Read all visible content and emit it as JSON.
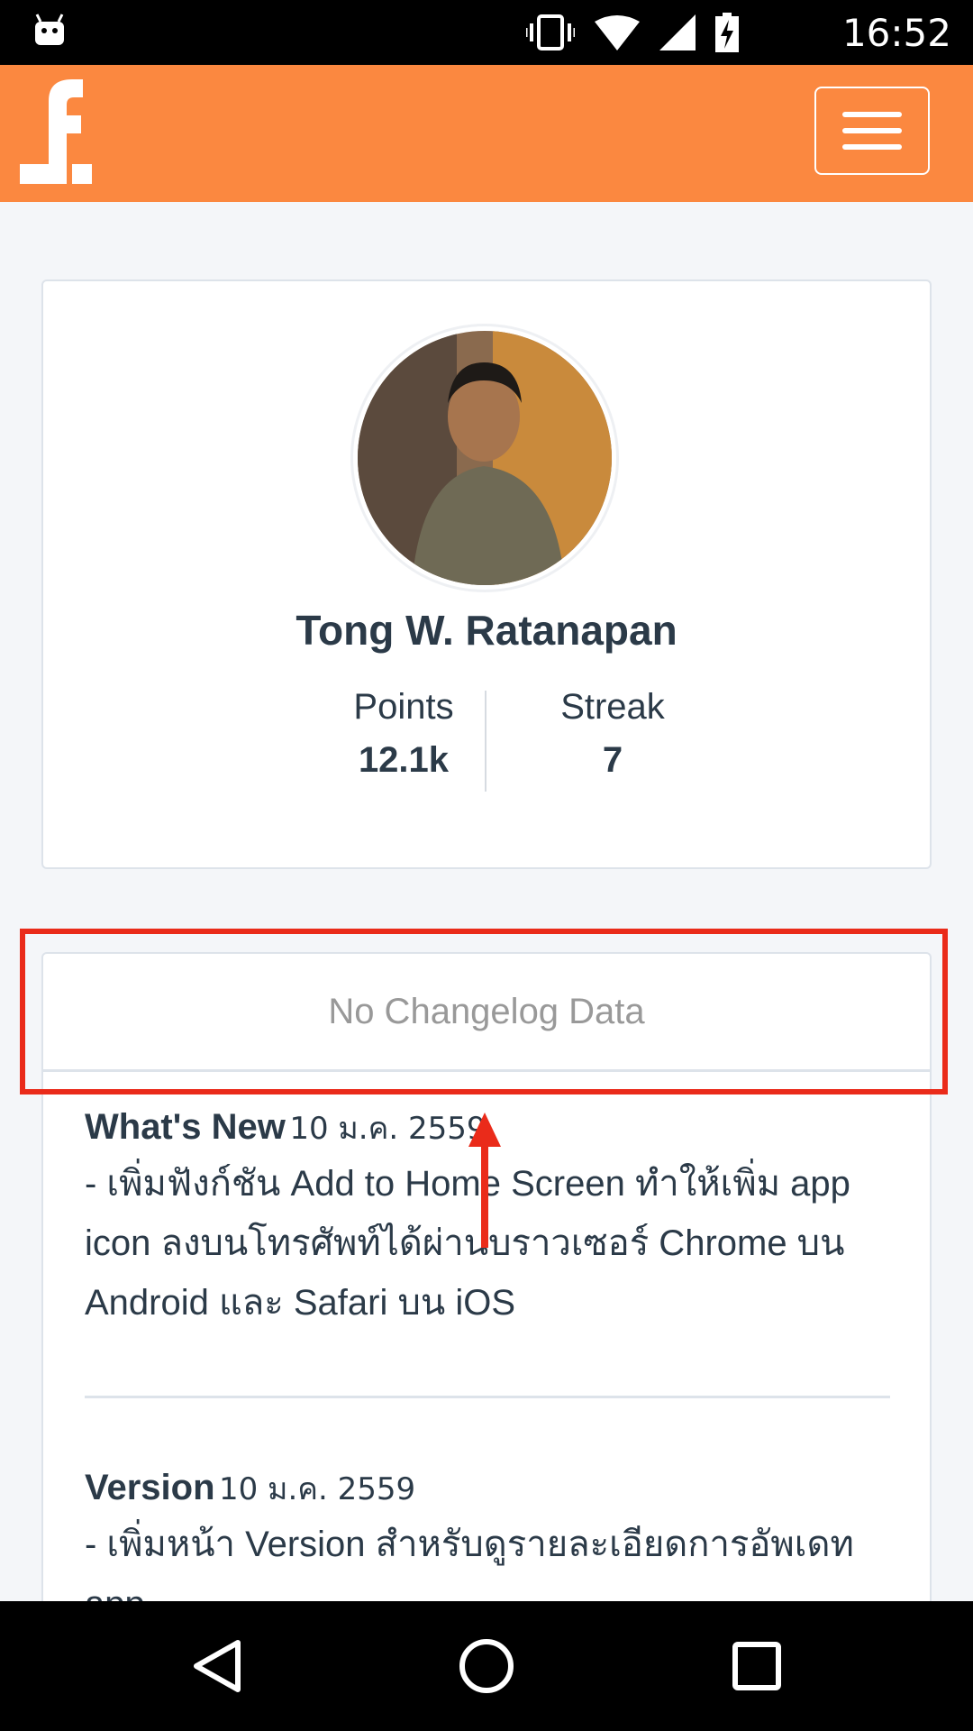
{
  "status_bar": {
    "time": "16:52",
    "icons": [
      "android-icon",
      "vibrate-icon",
      "wifi-icon",
      "signal-icon",
      "battery-charging-icon"
    ]
  },
  "header": {
    "logo_icon": "f-logo-icon",
    "menu_icon": "hamburger-menu-icon",
    "background_color": "#fb8840"
  },
  "profile": {
    "name": "Tong W. Ratanapan",
    "points_label": "Points",
    "points_value": "12.1k",
    "streak_label": "Streak",
    "streak_value": "7"
  },
  "changelog": {
    "empty_message": "No Changelog Data",
    "entries": [
      {
        "title": "What's New",
        "date": "10 ม.ค. 2559",
        "description": "- เพิ่มฟังก์ชัน Add to Home Screen ทำให้เพิ่ม app icon ลงบนโทรศัพท์ได้ผ่านบราวเซอร์ Chrome บน Android และ Safari บน iOS"
      },
      {
        "title": "Version",
        "date": "10 ม.ค. 2559",
        "description": "- เพิ่มหน้า Version สำหรับดูรายละเอียดการอัพเดท app"
      }
    ]
  },
  "annotation": {
    "highlight_color": "#ea2b1a"
  },
  "nav_bar": {
    "icons": [
      "back-icon",
      "home-icon",
      "recents-icon"
    ]
  }
}
